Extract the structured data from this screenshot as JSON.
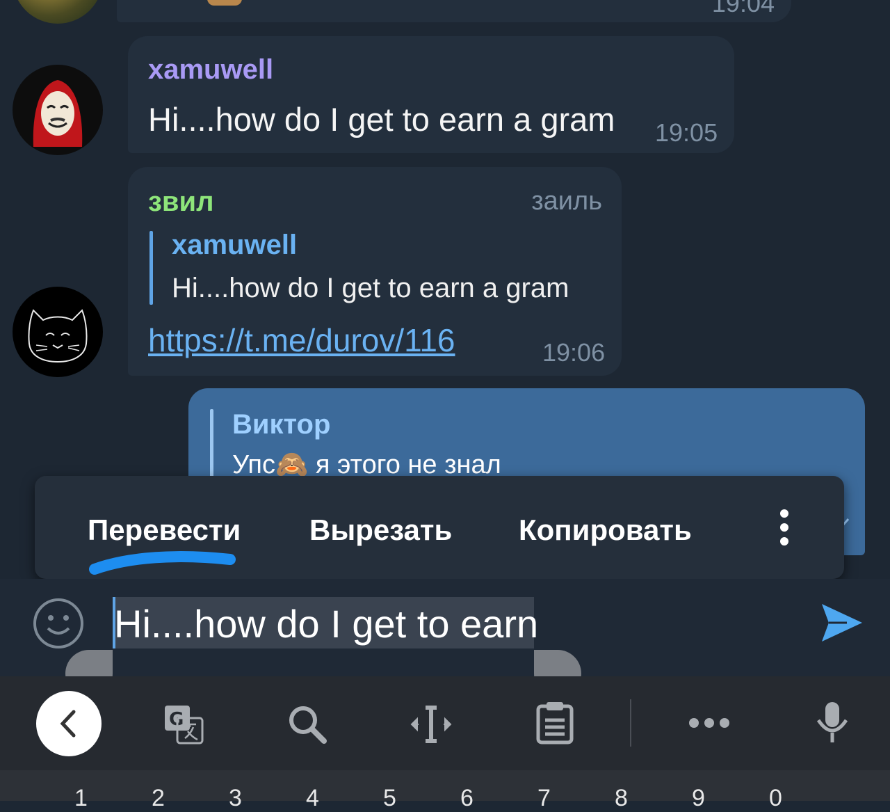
{
  "chat": {
    "prev_time": "19:04",
    "messages": [
      {
        "sender": "xamuwell",
        "text": "Hi....how do I get to earn a gram",
        "time": "19:05"
      },
      {
        "sender": "звил",
        "admin_label": "заиль",
        "reply_sender": "xamuwell",
        "reply_text": "Hi....how do I get to earn a gram",
        "link": "https://t.me/durov/116",
        "time": "19:06"
      },
      {
        "reply_sender": "Виктор",
        "reply_text_before": "Упс",
        "reply_emoji": "🙈",
        "reply_text_after": " я этого не знал"
      }
    ]
  },
  "context_menu": {
    "translate": "Перевести",
    "cut": "Вырезать",
    "copy": "Копировать"
  },
  "input": {
    "value": "Hi....how do I get to earn"
  },
  "keyboard": {
    "digits": [
      "1",
      "2",
      "3",
      "4",
      "5",
      "6",
      "7",
      "8",
      "9",
      "0"
    ]
  },
  "colors": {
    "background": "#1d2733",
    "bubble_in": "#232f3d",
    "bubble_out": "#3c6a9a",
    "sender_xamuwell": "#a99af5",
    "sender_zvil": "#8ee57a",
    "link": "#6ab2f2",
    "accent": "#5fa4e6",
    "annotation": "#1d8df0"
  }
}
